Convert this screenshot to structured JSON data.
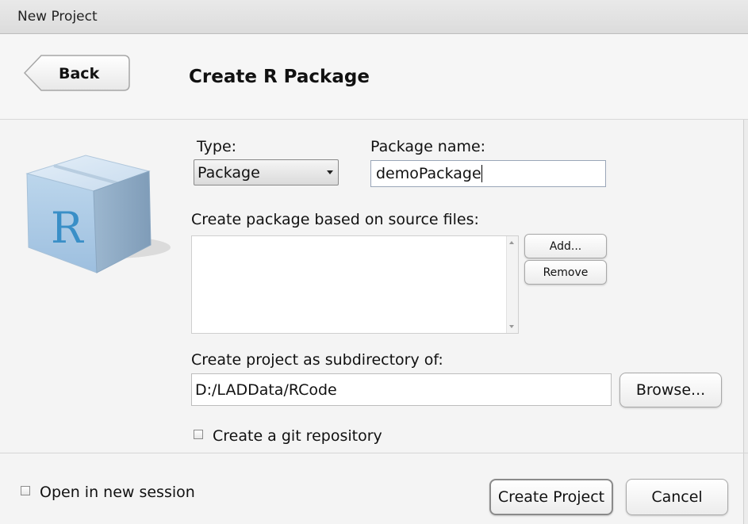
{
  "window": {
    "title": "New Project"
  },
  "header": {
    "back_label": "Back",
    "page_title": "Create R Package"
  },
  "form": {
    "type_label": "Type:",
    "type_value": "Package",
    "name_label": "Package name:",
    "name_value": "demoPackage",
    "source_files_label": "Create package based on source files:",
    "add_label": "Add...",
    "remove_label": "Remove",
    "subdir_label": "Create project as subdirectory of:",
    "subdir_value": "D:/LADData/RCode",
    "browse_label": "Browse...",
    "git_label": "Create a git repository"
  },
  "footer": {
    "new_session_label": "Open in new session",
    "create_label": "Create Project",
    "cancel_label": "Cancel"
  },
  "icons": {
    "logo": "r-package-cube-icon"
  }
}
